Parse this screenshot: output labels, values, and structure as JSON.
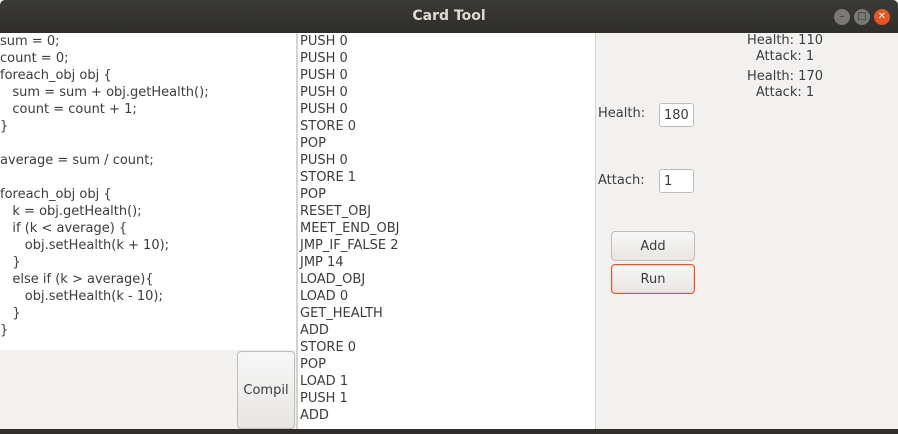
{
  "window": {
    "title": "Card Tool"
  },
  "code_editor": {
    "lines": [
      "sum = 0;",
      "count = 0;",
      "foreach_obj obj {",
      "   sum = sum + obj.getHealth();",
      "   count = count + 1;",
      "}",
      "",
      "average = sum / count;",
      "",
      "foreach_obj obj {",
      "   k = obj.getHealth();",
      "   if (k < average) {",
      "      obj.setHealth(k + 10);",
      "   }",
      "   else if (k > average){",
      "      obj.setHealth(k - 10);",
      "   }",
      "}"
    ]
  },
  "compile_button": {
    "label": "Compil"
  },
  "bytecode": {
    "lines": [
      "PUSH 0",
      "PUSH 0",
      "PUSH 0",
      "PUSH 0",
      "PUSH 0",
      "STORE 0",
      "POP",
      "PUSH 0",
      "STORE 1",
      "POP",
      "RESET_OBJ",
      "MEET_END_OBJ",
      "JMP_IF_FALSE 2",
      "JMP 14",
      "LOAD_OBJ",
      "LOAD 0",
      "GET_HEALTH",
      "ADD",
      "STORE 0",
      "POP",
      "LOAD 1",
      "PUSH 1",
      "ADD"
    ]
  },
  "form": {
    "health_label": "Health:",
    "health_value": "180",
    "attack_label": "Attach:",
    "attack_value": "1",
    "add_label": "Add",
    "run_label": "Run"
  },
  "cards": [
    {
      "health": "Health: 110",
      "attack": "Attack: 1"
    },
    {
      "health": "Health: 170",
      "attack": "Attack: 1"
    }
  ]
}
